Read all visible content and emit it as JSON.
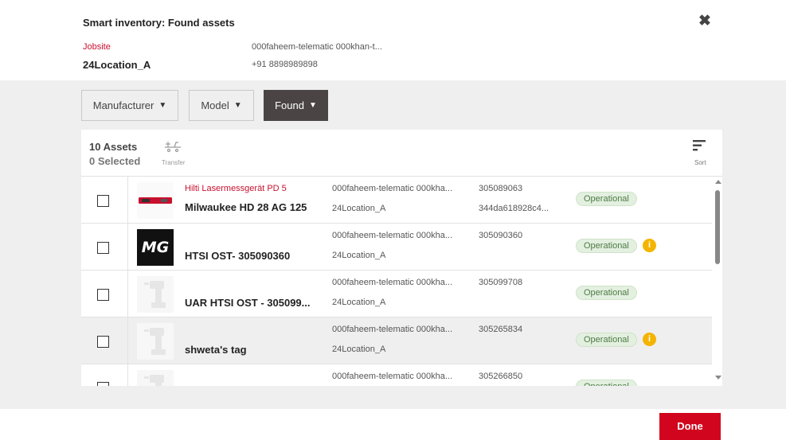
{
  "dialog": {
    "title": "Smart inventory: Found assets",
    "jobsite_label": "Jobsite",
    "jobsite_value": "24Location_A",
    "owner_line": "000faheem-telematic 000khan-t...",
    "phone_line": "+91 8898989898",
    "close_icon": "close-icon"
  },
  "filters": [
    {
      "label": "Manufacturer",
      "active": false
    },
    {
      "label": "Model",
      "active": false
    },
    {
      "label": "Found",
      "active": true
    }
  ],
  "list_header": {
    "assets_count": "10 Assets",
    "selected_count": "0 Selected",
    "transfer_label": "Transfer",
    "sort_label": "Sort"
  },
  "assets": [
    {
      "subtitle": "Hilti Lasermessgerät PD 5",
      "name": "Milwaukee HD 28 AG 125",
      "owner": "000faheem-telematic 000kha...",
      "location": "24Location_A",
      "serial": "305089063",
      "serial2": "344da618928c4...",
      "status": "Operational",
      "info": false,
      "thumb": "laser-image"
    },
    {
      "subtitle": "",
      "name": "HTSI OST- 305090360",
      "owner": "000faheem-telematic 000kha...",
      "location": "24Location_A",
      "serial": "305090360",
      "serial2": "",
      "status": "Operational",
      "info": true,
      "thumb": "mg-logo"
    },
    {
      "subtitle": "",
      "name": "UAR HTSI OST - 305099...",
      "owner": "000faheem-telematic 000kha...",
      "location": "24Location_A",
      "serial": "305099708",
      "serial2": "",
      "status": "Operational",
      "info": false,
      "thumb": "drill-placeholder"
    },
    {
      "subtitle": "",
      "name": "shweta's tag",
      "owner": "000faheem-telematic 000kha...",
      "location": "24Location_A",
      "serial": "305265834",
      "serial2": "",
      "status": "Operational",
      "info": true,
      "thumb": "drill-placeholder"
    },
    {
      "subtitle": "",
      "name": "",
      "owner": "000faheem-telematic 000kha...",
      "location": "",
      "serial": "305266850",
      "serial2": "",
      "status": "Operational",
      "info": false,
      "thumb": "drill-placeholder"
    }
  ],
  "info_glyph": "i",
  "thumb_logo_text": "MG",
  "footer": {
    "done_label": "Done"
  },
  "colors": {
    "accent": "#d2051e",
    "subtitle_red": "#c8102e",
    "status_bg": "#e3f0e0",
    "status_text": "#4f7a44",
    "info": "#f4b400",
    "active_filter": "#4a4445"
  }
}
